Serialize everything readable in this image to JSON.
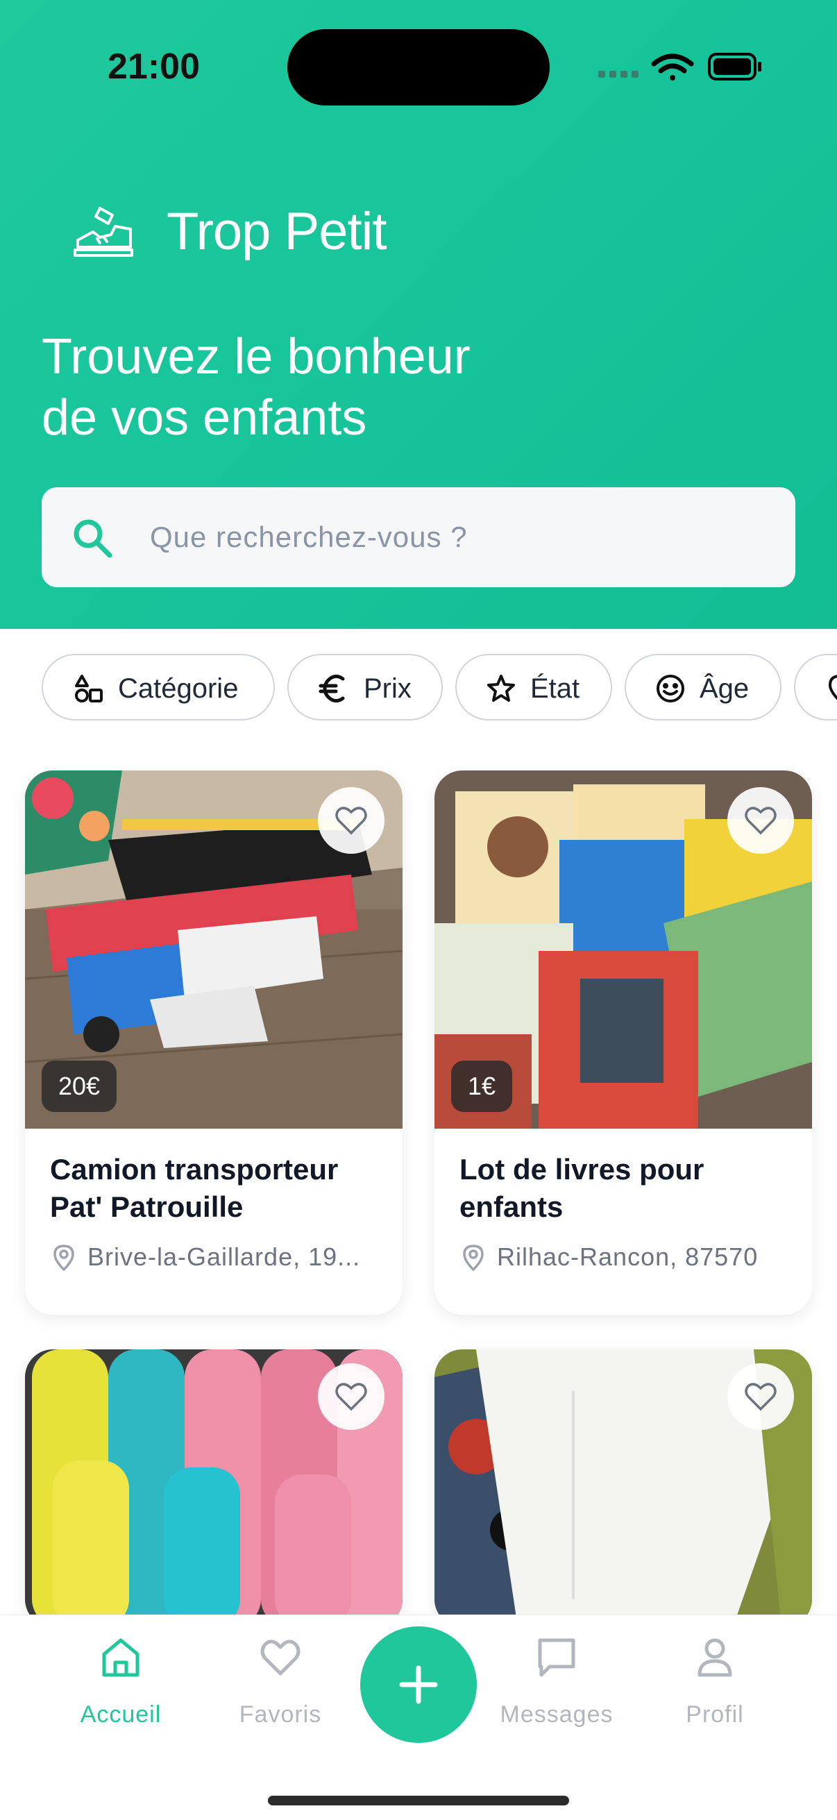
{
  "status_bar": {
    "time": "21:00"
  },
  "brand": {
    "name": "Trop Petit",
    "icon": "sneaker-icon"
  },
  "headline": {
    "line1": "Trouvez le bonheur",
    "line2": "de vos enfants"
  },
  "search": {
    "placeholder": "Que recherchez-vous ?",
    "icon": "search-icon"
  },
  "filters": [
    {
      "label": "Catégorie",
      "icon": "shapes-icon"
    },
    {
      "label": "Prix",
      "icon": "euro-icon"
    },
    {
      "label": "État",
      "icon": "star-icon"
    },
    {
      "label": "Âge",
      "icon": "face-icon"
    },
    {
      "label": "",
      "icon": "location-icon"
    }
  ],
  "listings": [
    {
      "title_line1": "Camion transporteur",
      "title_line2": "Pat' Patrouille",
      "price": "20€",
      "location": "Brive-la-Gaillarde, 19..."
    },
    {
      "title_line1": "Lot de livres pour",
      "title_line2": "enfants",
      "price": "1€",
      "location": "Rilhac-Rancon, 87570"
    },
    {
      "title_line1": "",
      "title_line2": "",
      "price": "",
      "location": ""
    },
    {
      "title_line1": "",
      "title_line2": "",
      "price": "",
      "location": ""
    }
  ],
  "tabs": [
    {
      "label": "Accueil",
      "icon": "home-icon",
      "active": true
    },
    {
      "label": "Favoris",
      "icon": "heart-icon",
      "active": false
    },
    {
      "label": "Messages",
      "icon": "message-icon",
      "active": false
    },
    {
      "label": "Profil",
      "icon": "profile-icon",
      "active": false
    }
  ],
  "colors": {
    "accent": "#1fc79a",
    "header_bg": "#17c49a",
    "text": "#111827",
    "muted": "#6b7280"
  }
}
